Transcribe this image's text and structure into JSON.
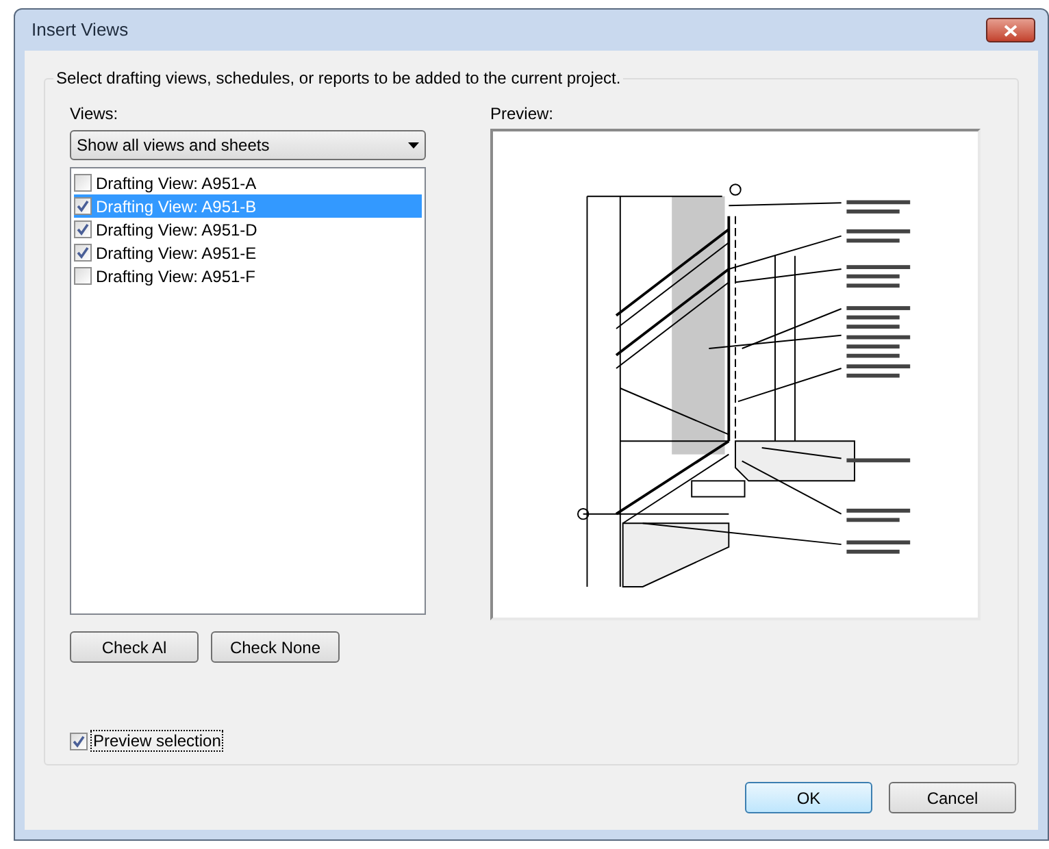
{
  "window": {
    "title": "Insert Views"
  },
  "group": {
    "legend": "Select drafting views, schedules, or reports to be added to the current project."
  },
  "views": {
    "label": "Views:",
    "filter": "Show all views and sheets",
    "items": [
      {
        "label": "Drafting View: A951-A",
        "checked": false,
        "selected": false
      },
      {
        "label": "Drafting View: A951-B",
        "checked": true,
        "selected": true
      },
      {
        "label": "Drafting View: A951-D",
        "checked": true,
        "selected": false
      },
      {
        "label": "Drafting View: A951-E",
        "checked": true,
        "selected": false
      },
      {
        "label": "Drafting View: A951-F",
        "checked": false,
        "selected": false
      }
    ]
  },
  "list_buttons": [
    "Check Al",
    "Check None"
  ],
  "preview": {
    "label": "Preview:"
  },
  "preview_selection": {
    "label": "Preview selection",
    "checked": true
  },
  "buttons": [
    {
      "label": "OK",
      "kind": "default"
    },
    {
      "label": "Cancel",
      "kind": "normal"
    }
  ]
}
